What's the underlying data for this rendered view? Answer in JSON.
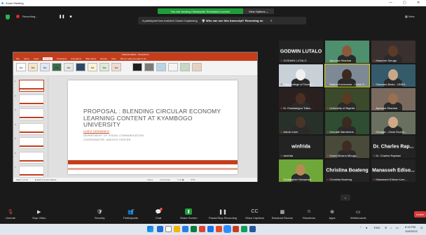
{
  "window": {
    "title": "Zoom Meeting",
    "controls": [
      "—",
      "▢",
      "✕"
    ]
  },
  "banner": {
    "text": "You are viewing Christopher Serwanko's screen",
    "view_options": "View Options ⌄"
  },
  "recording": {
    "label": "Recording...",
    "pause": "❚❚",
    "stop": "■"
  },
  "view_label": "▦ View",
  "caption_notice": {
    "text": "A participant has enabled Closed Captioning",
    "question": "🛡 Who can see this transcript? Recording on",
    "close": "✕"
  },
  "ppt": {
    "title": "CIRCLE IDEAS - PowerPoint",
    "tabs": [
      "File",
      "Home",
      "Insert",
      "Design",
      "Transitions",
      "Animations",
      "Slide Show",
      "Review",
      "View",
      "Tell me what you want to do"
    ],
    "active_tab": "Design",
    "themes": [
      "Aa",
      "Aa",
      "Aa",
      "Aa",
      "Aa",
      "Aa",
      "Aa",
      "Aa",
      "Aa"
    ],
    "thumb_numbers": [
      "1",
      "2",
      "3",
      "4",
      "5",
      "6",
      "7"
    ],
    "slide": {
      "title": "PROPOSAL : BLENDING CIRCULAR ECONOMY LEARNING CONTENT AT KYAMBOGO UNIVERSITY",
      "author": "CHRIS SERWANKO",
      "dept": "DEPARTMENT OF VISUAL COMMUNICATION",
      "coord": "COORDINATOR: UNESCO CENTER"
    },
    "status": [
      "Slide 1 of 13",
      "English (United States)",
      "Notes",
      "Comments",
      "▭ ⊞ ▣",
      "57%"
    ]
  },
  "participants": [
    {
      "name": "GODWIN LUTALO",
      "big_label": "GODWIN LUTALO",
      "type": "name"
    },
    {
      "name": "Apoorva Shankar",
      "type": "video",
      "bg": "#4e8f6e",
      "skin": "#8a5a3c"
    },
    {
      "name": "Maureen Serugo",
      "type": "video",
      "bg": "#3a3030",
      "skin": "#5a3a28"
    },
    {
      "name": "Yaba college of Techno...",
      "type": "video",
      "bg": "#c8d0d8",
      "skin": "#f0f0f0"
    },
    {
      "name": "Solera Kuciovuwe - Circle E...",
      "type": "video",
      "bg": "#7d8a96",
      "skin": "#3b2a20",
      "active": true
    },
    {
      "name": "Giacomo Bosio - UNES...",
      "type": "video",
      "bg": "#355a6a",
      "skin": "#c8a888"
    },
    {
      "name": "Dr Oluwasegun Tuika...",
      "type": "video",
      "bg": "#2a2020",
      "skin": "#4a3020"
    },
    {
      "name": "University of Nigeria",
      "type": "video",
      "bg": "#3a4a2a",
      "skin": "#5a3a24"
    },
    {
      "name": "Apoorva Shankar",
      "type": "video",
      "bg": "#7a6a60",
      "skin": "#9a7050"
    },
    {
      "name": "Admin User",
      "type": "video",
      "bg": "#28302a",
      "skin": "#4a3428"
    },
    {
      "name": "Kenneth Barrientos",
      "type": "video",
      "bg": "#2e4d32",
      "skin": "#3a2a20"
    },
    {
      "name": "Georgie - Circle Econo...",
      "type": "video",
      "bg": "#6a7060",
      "skin": "#d0a888"
    },
    {
      "name": "winfrida",
      "big_label": "winfrida",
      "type": "name"
    },
    {
      "name": "David Silvano Mbuga...",
      "type": "video",
      "bg": "#4a4a3a",
      "skin": "#3e2c22"
    },
    {
      "name": "Dr. Charles Raphael",
      "big_label": "Dr. Charles Rap...",
      "type": "name"
    },
    {
      "name": "Christopher Serwanko",
      "type": "video",
      "bg": "#6fa83a",
      "skin": "#b88a55"
    },
    {
      "name": "Christina Boateng",
      "big_label": "Christina Boateng",
      "type": "name"
    },
    {
      "name": "Manasseh Edison Kom...",
      "big_label": "Manasseh Ediso...",
      "type": "name"
    }
  ],
  "toolbar": [
    {
      "label": "Unmute",
      "icon": "🎙"
    },
    {
      "label": "Stop Video",
      "icon": "▶"
    },
    {
      "label": "Security",
      "icon": "🛡"
    },
    {
      "label": "Participants",
      "icon": "👥",
      "count": "27"
    },
    {
      "label": "Chat",
      "icon": "💬",
      "badge": "3"
    },
    {
      "label": "Share Screen",
      "icon": "⬆"
    },
    {
      "label": "Pause/Stop Recording",
      "icon": "❚❚"
    },
    {
      "label": "Show Captions",
      "icon": "CC"
    },
    {
      "label": "Breakout Rooms",
      "icon": "▦"
    },
    {
      "label": "Reactions",
      "icon": "☺"
    },
    {
      "label": "Apps",
      "icon": "⊕"
    },
    {
      "label": "Whiteboards",
      "icon": "▭"
    }
  ],
  "leave_label": "Leave",
  "scroll_down": "⌄",
  "taskbar": {
    "time": "6:19 PM",
    "date": "10/5/2022",
    "lang": "ENG",
    "apps": [
      "#1f6fd1",
      "#ffffff",
      "#f0b400",
      "#2a7de1",
      "#0a7d3a",
      "#db4437",
      "#1a73e8",
      "#e34c26",
      "#2d8cff",
      "#c43e1c",
      "#0f9d58",
      "#2b579a"
    ]
  }
}
